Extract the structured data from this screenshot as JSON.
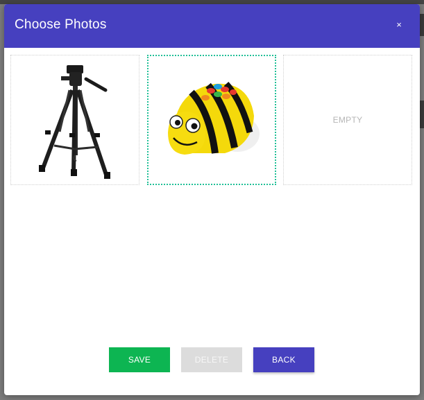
{
  "modal": {
    "title": "Choose Photos",
    "close_label": "×"
  },
  "slots": [
    {
      "state": "filled",
      "photo_icon": "tripod-photo",
      "selected": false
    },
    {
      "state": "filled",
      "photo_icon": "bee-bot-photo",
      "selected": true
    },
    {
      "state": "empty",
      "label": "EMPTY",
      "selected": false
    }
  ],
  "buttons": {
    "save_label": "SAVE",
    "delete_label": "DELETE",
    "back_label": "BACK"
  },
  "colors": {
    "header": "#4640bf",
    "save": "#0db552",
    "delete_disabled": "#dcdcdc",
    "back": "#4640bf",
    "selected_border": "#1fbf96"
  }
}
